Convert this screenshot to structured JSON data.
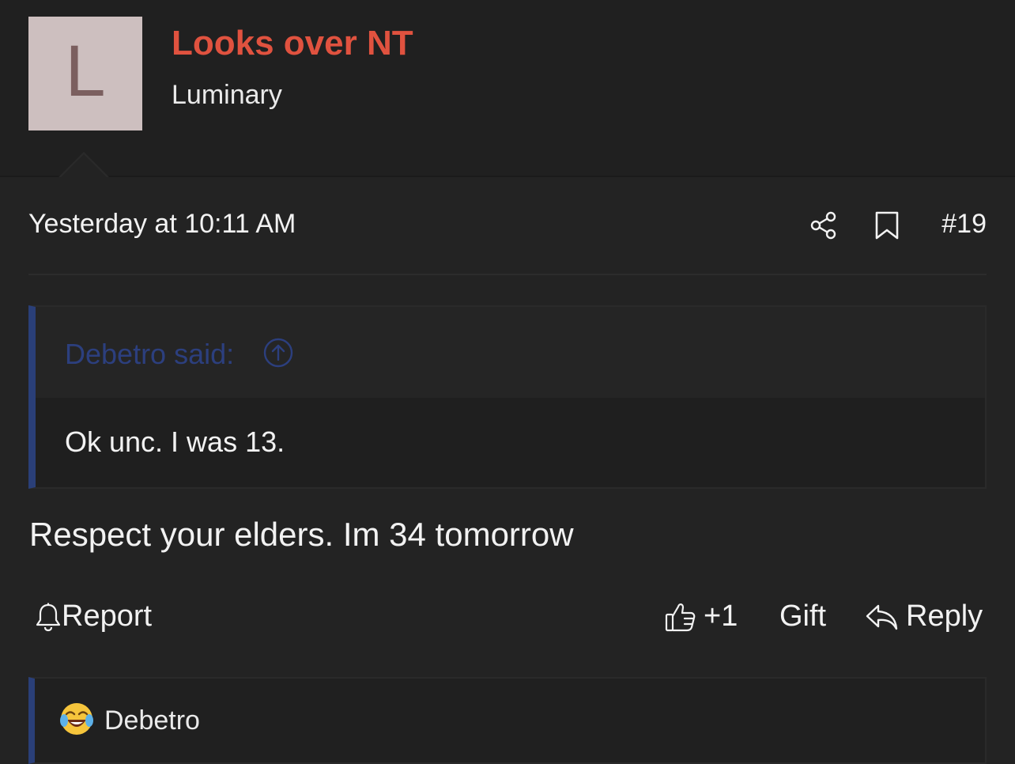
{
  "user": {
    "avatar_letter": "L",
    "name": "Looks over NT",
    "title": "Luminary",
    "name_color": "#e0523f"
  },
  "post": {
    "date": "Yesterday at 10:11 AM",
    "number": "#19",
    "meta_icons": [
      "share-icon",
      "bookmark-icon"
    ],
    "body": "Respect your elders. Im 34 tomorrow"
  },
  "quote": {
    "author": "Debetro said:",
    "text": "Ok unc. I was 13.",
    "accent_color": "#2a3f78"
  },
  "actions": {
    "report": "Report",
    "like": "+1",
    "gift": "Gift",
    "reply": "Reply"
  },
  "reactions": {
    "emoji": "tears-of-joy-emoji",
    "user": "Debetro"
  }
}
